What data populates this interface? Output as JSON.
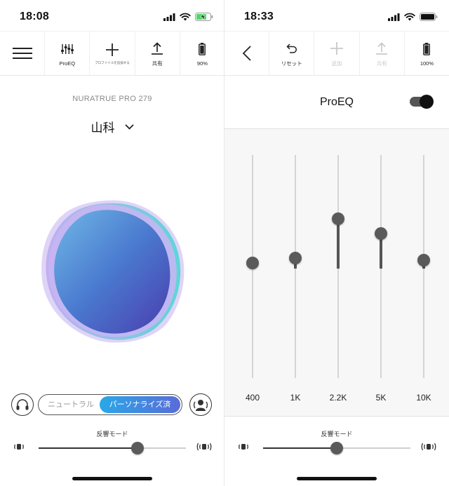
{
  "left": {
    "status": {
      "time": "18:08"
    },
    "toolbar": {
      "proeq_label": "ProEQ",
      "add_profile_label": "プロファイルを追加する",
      "share_label": "共有",
      "battery_label": "90%"
    },
    "device_name": "NURATRUE PRO 279",
    "profile_name": "山科",
    "mode": {
      "neutral_label": "ニュートラル",
      "personalized_label": "パーソナライズ済"
    },
    "immersion": {
      "label": "反響モード",
      "level": 0.67
    }
  },
  "right": {
    "status": {
      "time": "18:33"
    },
    "toolbar": {
      "reset_label": "リセット",
      "add_label": "追加",
      "share_label": "共有",
      "battery_label": "100%"
    },
    "eq": {
      "title": "ProEQ",
      "enabled": true,
      "bands": [
        {
          "freq": "400",
          "level": 0.0
        },
        {
          "freq": "1K",
          "level": 0.05
        },
        {
          "freq": "2.2K",
          "level": 0.43
        },
        {
          "freq": "5K",
          "level": 0.29
        },
        {
          "freq": "10K",
          "level": 0.03
        }
      ]
    },
    "immersion": {
      "label": "反響モード",
      "level": 0.5
    }
  },
  "colors": {
    "segment_gradient_start": "#2aa8e8",
    "segment_gradient_end": "#5a6bd8",
    "battery_charging": "#4cd964",
    "disabled": "#c8c8c8"
  }
}
